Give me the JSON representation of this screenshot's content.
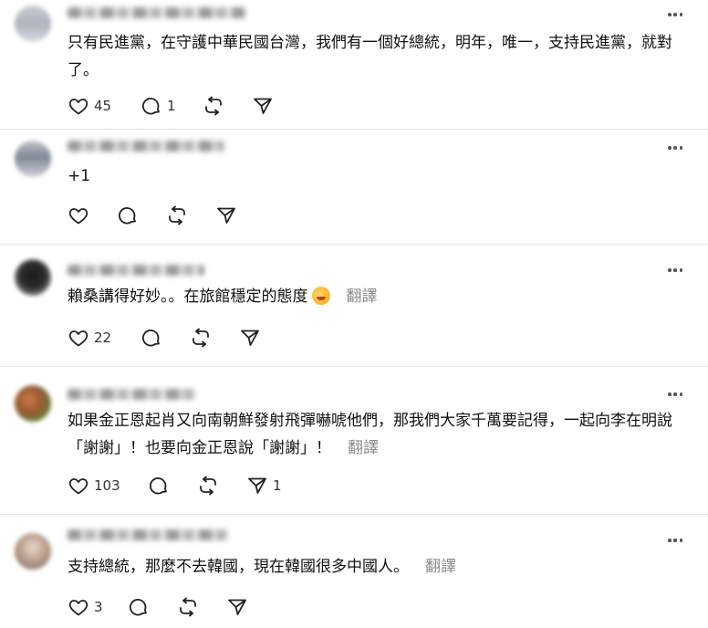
{
  "ui": {
    "translate_label": "翻譯"
  },
  "comments": [
    {
      "text": "只有民進黨，在守護中華民國台灣，我們有一個好總統，明年，唯一，支持民進黨，就對了。",
      "likes": "45",
      "replies": "1",
      "reposts": "",
      "shares": ""
    },
    {
      "text": "+1",
      "likes": "",
      "replies": "",
      "reposts": "",
      "shares": ""
    },
    {
      "text": "賴桑講得好妙。。在旅館穩定的態度",
      "emoji": "rolling-on-floor-laughing-emoji",
      "likes": "22",
      "replies": "",
      "reposts": "",
      "shares": ""
    },
    {
      "text": "如果金正恩起肖又向南朝鮮發射飛彈嚇唬他們，那我們大家千萬要記得，一起向李在明說「謝謝」！也要向金正恩說「謝謝」！",
      "likes": "103",
      "replies": "",
      "reposts": "",
      "shares": "1"
    },
    {
      "text": "支持總統，那麼不去韓國，現在韓國很多中國人。",
      "likes": "3",
      "replies": "",
      "reposts": "",
      "shares": ""
    }
  ],
  "colors": {
    "text": "#111111",
    "muted": "#8a8a8a",
    "divider": "#e4e4e4"
  }
}
